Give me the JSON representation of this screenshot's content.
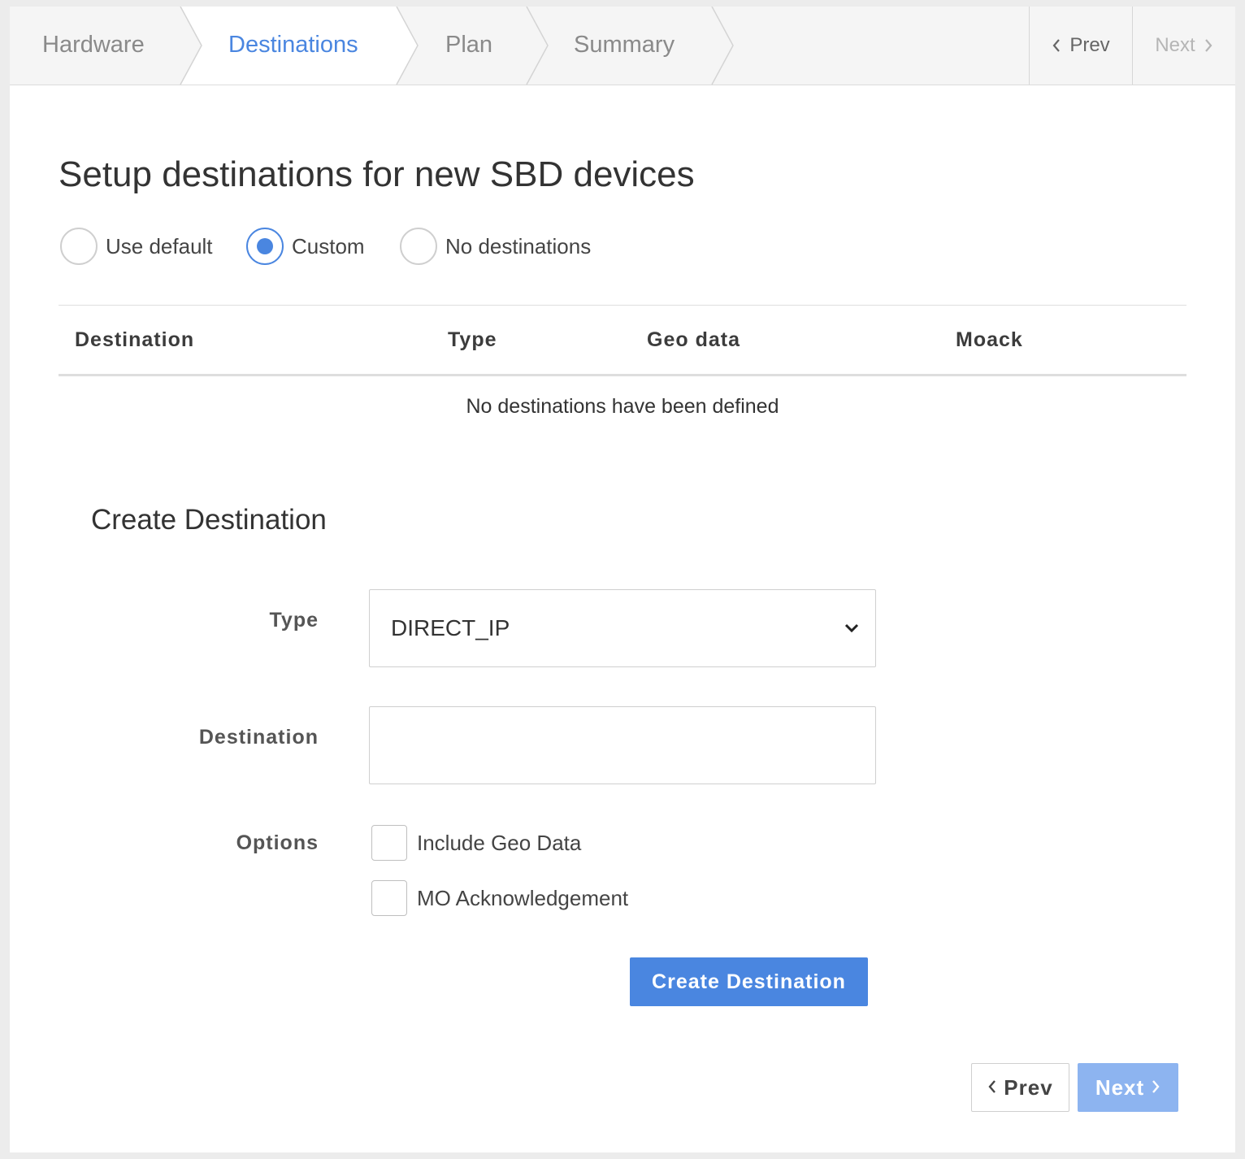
{
  "wizard": {
    "steps": [
      {
        "label": "Hardware",
        "active": false
      },
      {
        "label": "Destinations",
        "active": true
      },
      {
        "label": "Plan",
        "active": false
      },
      {
        "label": "Summary",
        "active": false
      }
    ],
    "prev_label": "Prev",
    "next_label": "Next",
    "prev_icon": "chevron-left-icon",
    "next_icon": "chevron-right-icon"
  },
  "page": {
    "title": "Setup destinations for new SBD devices"
  },
  "mode_options": {
    "items": [
      {
        "label": "Use default",
        "checked": false
      },
      {
        "label": "Custom",
        "checked": true
      },
      {
        "label": "No destinations",
        "checked": false
      }
    ]
  },
  "table": {
    "columns": [
      "Destination",
      "Type",
      "Geo data",
      "Moack"
    ],
    "rows": [],
    "empty_message": "No destinations have been defined"
  },
  "create_form": {
    "title": "Create Destination",
    "type_label": "Type",
    "type_value": "DIRECT_IP",
    "destination_label": "Destination",
    "destination_value": "",
    "options_label": "Options",
    "options": [
      {
        "label": "Include Geo Data",
        "checked": false
      },
      {
        "label": "MO Acknowledgement",
        "checked": false
      }
    ],
    "submit_label": "Create Destination"
  },
  "footer": {
    "prev_label": "Prev",
    "next_label": "Next"
  },
  "colors": {
    "accent": "#4a86e0",
    "accent_disabled": "#8db4f0",
    "header_bg": "#f5f5f5",
    "page_bg": "#ececec"
  }
}
